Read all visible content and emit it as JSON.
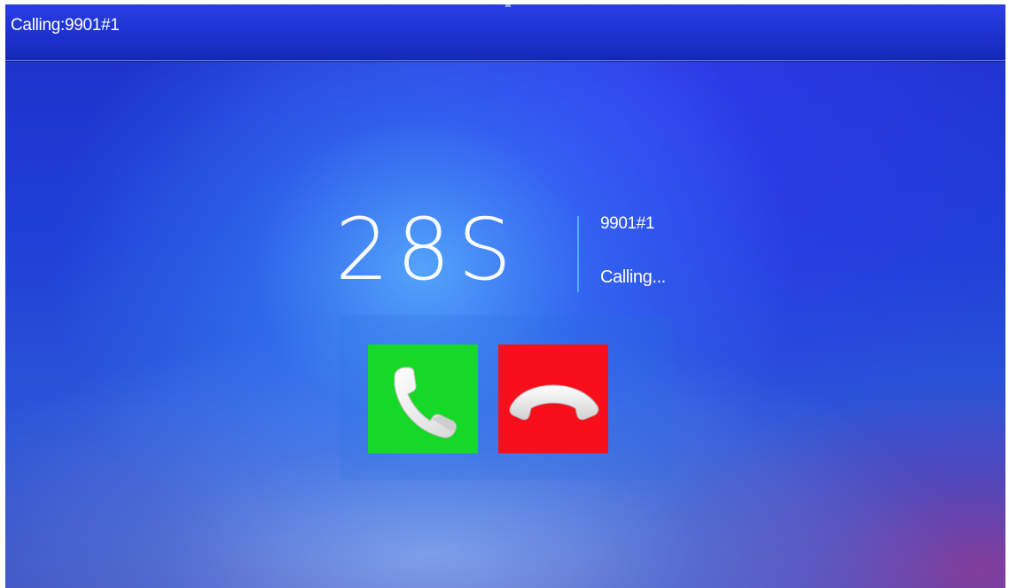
{
  "window": {
    "title": "Calling:9901#1"
  },
  "call": {
    "timer": "28S",
    "caller_id": "9901#1",
    "status": "Calling..."
  },
  "buttons": {
    "answer_icon": "phone-answer-icon",
    "hangup_icon": "phone-hangup-icon"
  },
  "colors": {
    "answer_button": "#16d826",
    "hangup_button": "#f80f1c",
    "titlebar": "#1f34d4",
    "divider": "#50beff"
  }
}
